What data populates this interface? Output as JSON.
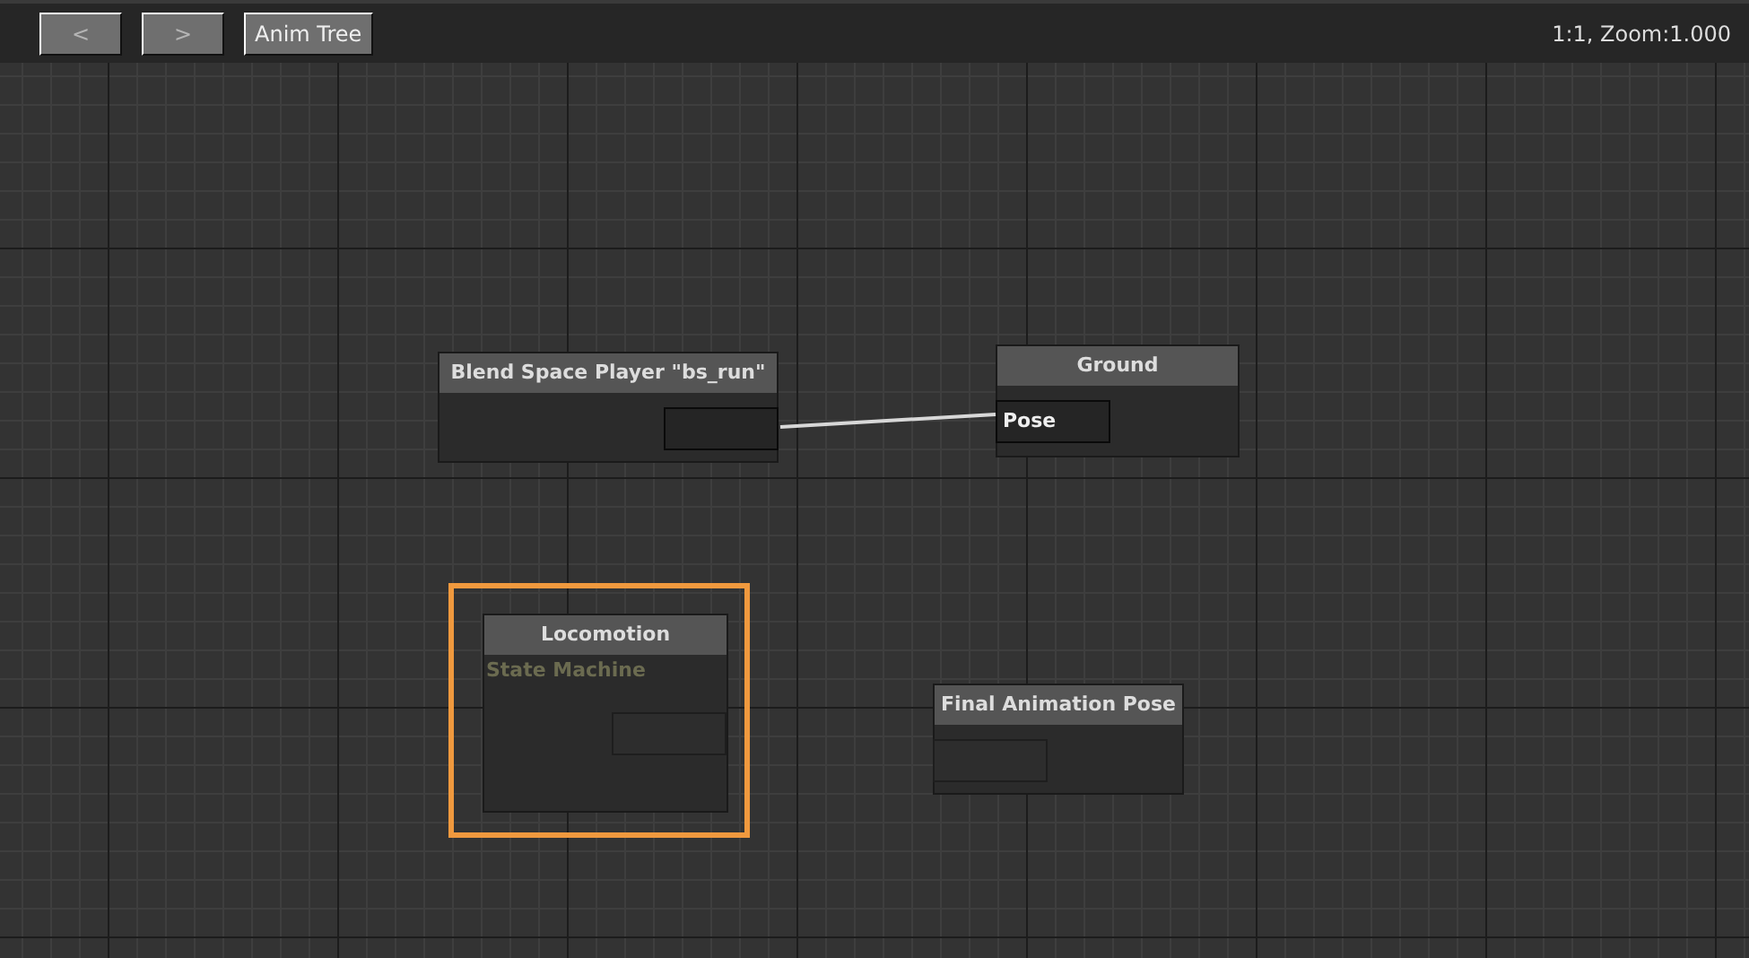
{
  "toolbar": {
    "buttons": [
      {
        "label": "<",
        "disabled": true
      },
      {
        "label": ">",
        "disabled": true
      },
      {
        "label": "Anim Tree",
        "disabled": false
      }
    ],
    "zoom_readout": "1:1, Zoom:1.000"
  },
  "graph": {
    "nodes": [
      {
        "title": "Blend Space Player \"bs_run\"",
        "selected": false,
        "sockets": [
          {
            "kind": "output",
            "connected": true
          }
        ]
      },
      {
        "title": "Ground",
        "selected": false,
        "sockets": [
          {
            "kind": "input",
            "label": "Pose",
            "connected": true
          }
        ]
      },
      {
        "title": "Locomotion",
        "subtitle": "State Machine",
        "selected": true,
        "sockets": [
          {
            "kind": "output"
          }
        ]
      },
      {
        "title": "Final Animation Pose",
        "selected": false,
        "sockets": [
          {
            "kind": "input"
          }
        ]
      }
    ]
  }
}
